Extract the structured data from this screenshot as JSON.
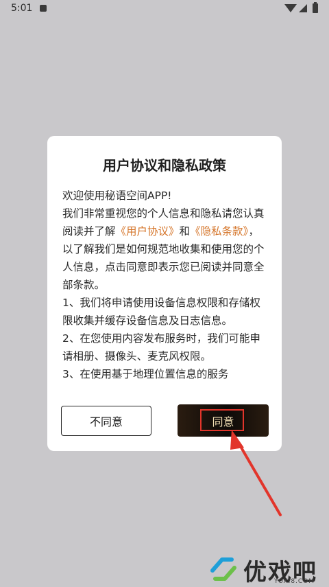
{
  "status_bar": {
    "time": "5:01"
  },
  "dialog": {
    "title": "用户协议和隐私政策",
    "paragraphs": [
      {
        "text": "欢迎使用秘语空间APP!"
      },
      {
        "prefix": "我们非常重视您的个人信息和隐私请您认真阅读并了解",
        "link1": "《用户协议》",
        "middle": "和",
        "link2": "《隐私条款》",
        "suffix": "，以了解我们是如何规范地收集和使用您的个人信息，点击同意即表示您已阅读并同意全部条款。"
      },
      {
        "text": "1、我们将申请使用设备信息权限和存储权限收集并缓存设备信息及日志信息。"
      },
      {
        "text": "2、在您使用内容发布服务时，我们可能申请相册、摄像头、麦克风权限。"
      },
      {
        "text": "3、在使用基于地理位置信息的服务"
      }
    ],
    "buttons": {
      "disagree": "不同意",
      "agree": "同意"
    }
  },
  "watermark": {
    "brand": "优戏吧",
    "domain": "YOXI8.COM"
  },
  "colors": {
    "link": "#d5752a",
    "highlight": "#e2352b",
    "agree_text": "#f3e0b5"
  }
}
